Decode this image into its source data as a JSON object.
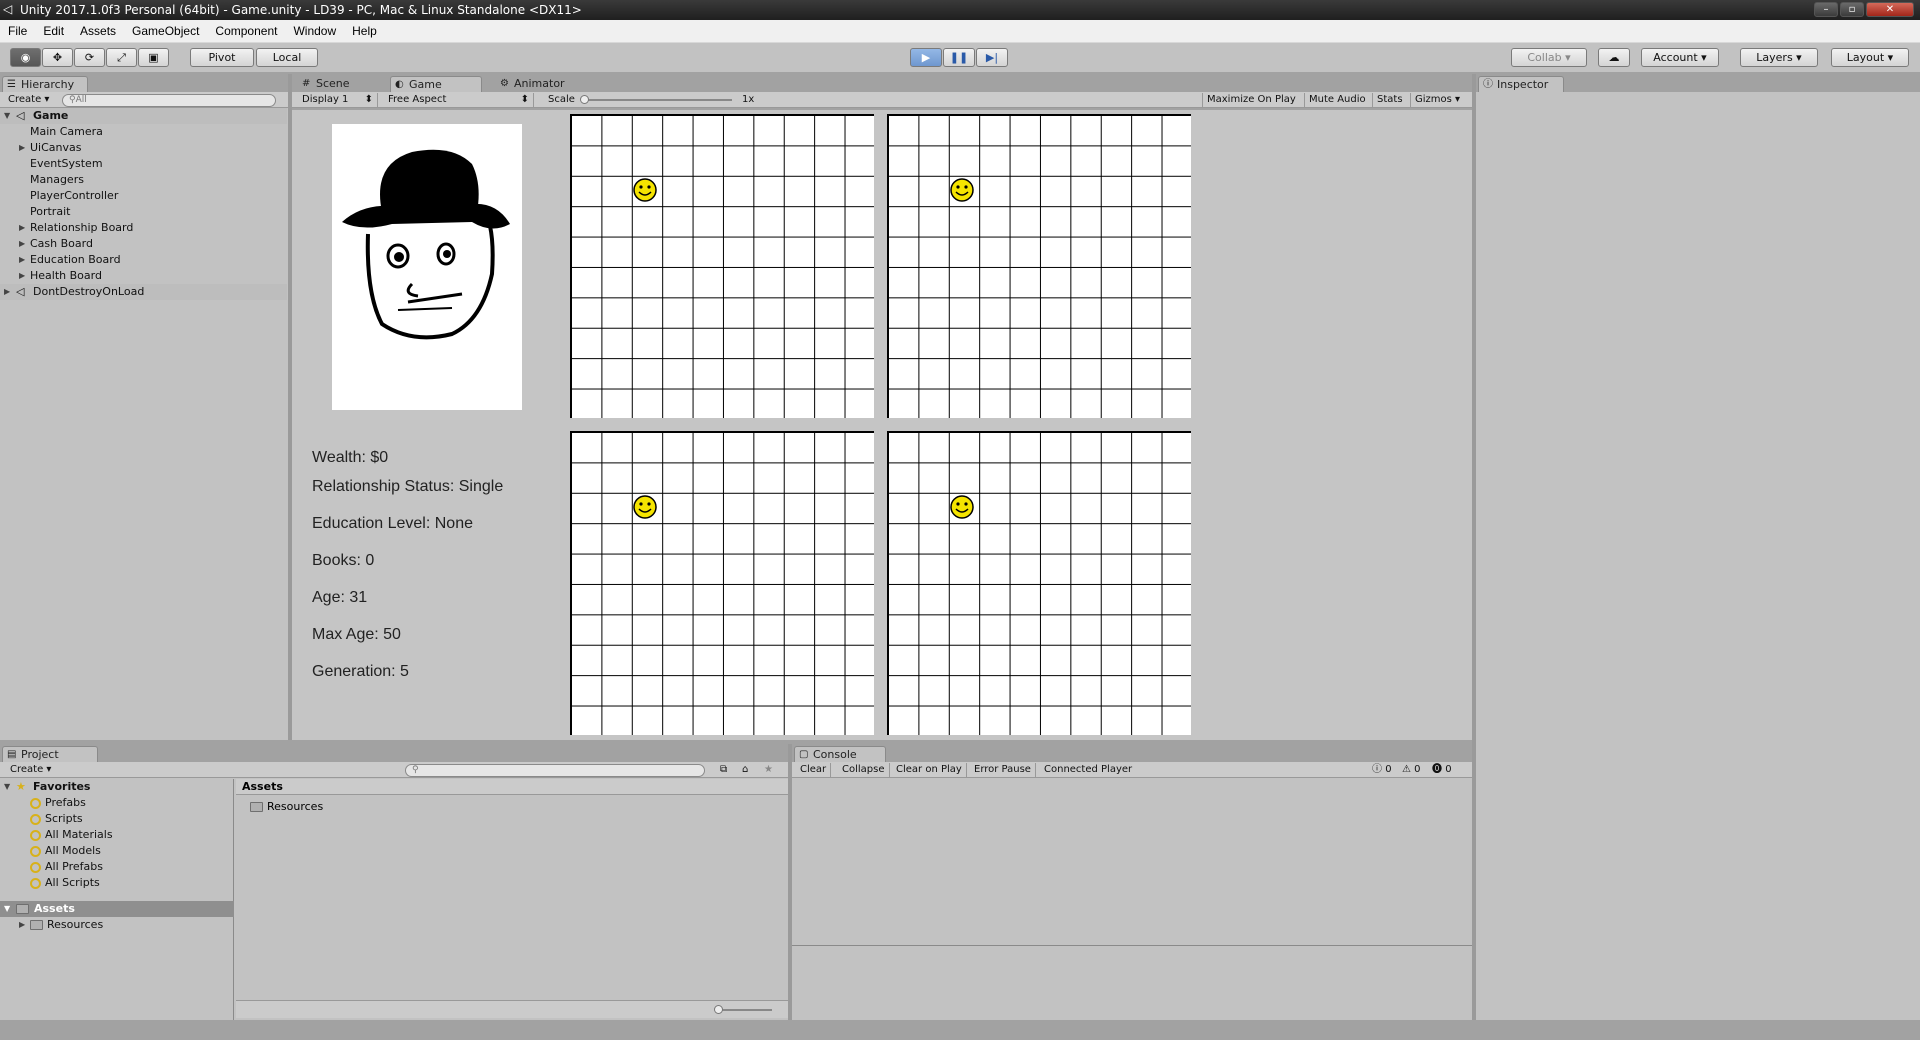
{
  "window": {
    "title": "Unity 2017.1.0f3 Personal (64bit) - Game.unity - LD39 - PC, Mac & Linux Standalone <DX11>"
  },
  "menu": [
    "File",
    "Edit",
    "Assets",
    "GameObject",
    "Component",
    "Window",
    "Help"
  ],
  "toolbar": {
    "pivot": "Pivot",
    "local": "Local",
    "collab": "Collab",
    "account": "Account",
    "layers": "Layers",
    "layout": "Layout"
  },
  "hierarchy": {
    "tab": "Hierarchy",
    "create": "Create",
    "search_placeholder": "All",
    "scene": "Game",
    "items": [
      "Main Camera",
      "UiCanvas",
      "EventSystem",
      "Managers",
      "PlayerController",
      "Portrait",
      "Relationship Board",
      "Cash Board",
      "Education Board",
      "Health Board"
    ],
    "ddol": "DontDestroyOnLoad"
  },
  "tabs": {
    "scene": "Scene",
    "game": "Game",
    "animator": "Animator",
    "inspector": "Inspector",
    "project": "Project",
    "console": "Console"
  },
  "game_toolbar": {
    "display": "Display 1",
    "aspect": "Free Aspect",
    "scale_label": "Scale",
    "scale_value": "1x",
    "maximize": "Maximize On Play",
    "mute": "Mute Audio",
    "stats": "Stats",
    "gizmos": "Gizmos"
  },
  "stats": {
    "wealth": "Wealth: $0",
    "relationship": "Relationship Status: Single",
    "education": "Education Level: None",
    "books": "Books:   0",
    "age": "Age:   31",
    "max_age": "Max Age:  50",
    "generation": "Generation: 5"
  },
  "boards": {
    "grid_size": 10,
    "smiley_cell": {
      "col": 2,
      "row": 2
    }
  },
  "project": {
    "create": "Create",
    "favorites": "Favorites",
    "fav_items": [
      "Prefabs",
      "Scripts",
      "All Materials",
      "All Models",
      "All Prefabs",
      "All Scripts"
    ],
    "assets": "Assets",
    "resources": "Resources",
    "content_header": "Assets",
    "content_item": "Resources"
  },
  "console": {
    "clear": "Clear",
    "collapse": "Collapse",
    "clear_on_play": "Clear on Play",
    "error_pause": "Error Pause",
    "connected": "Connected Player",
    "info_count": "0",
    "warn_count": "0",
    "error_count": "0"
  }
}
